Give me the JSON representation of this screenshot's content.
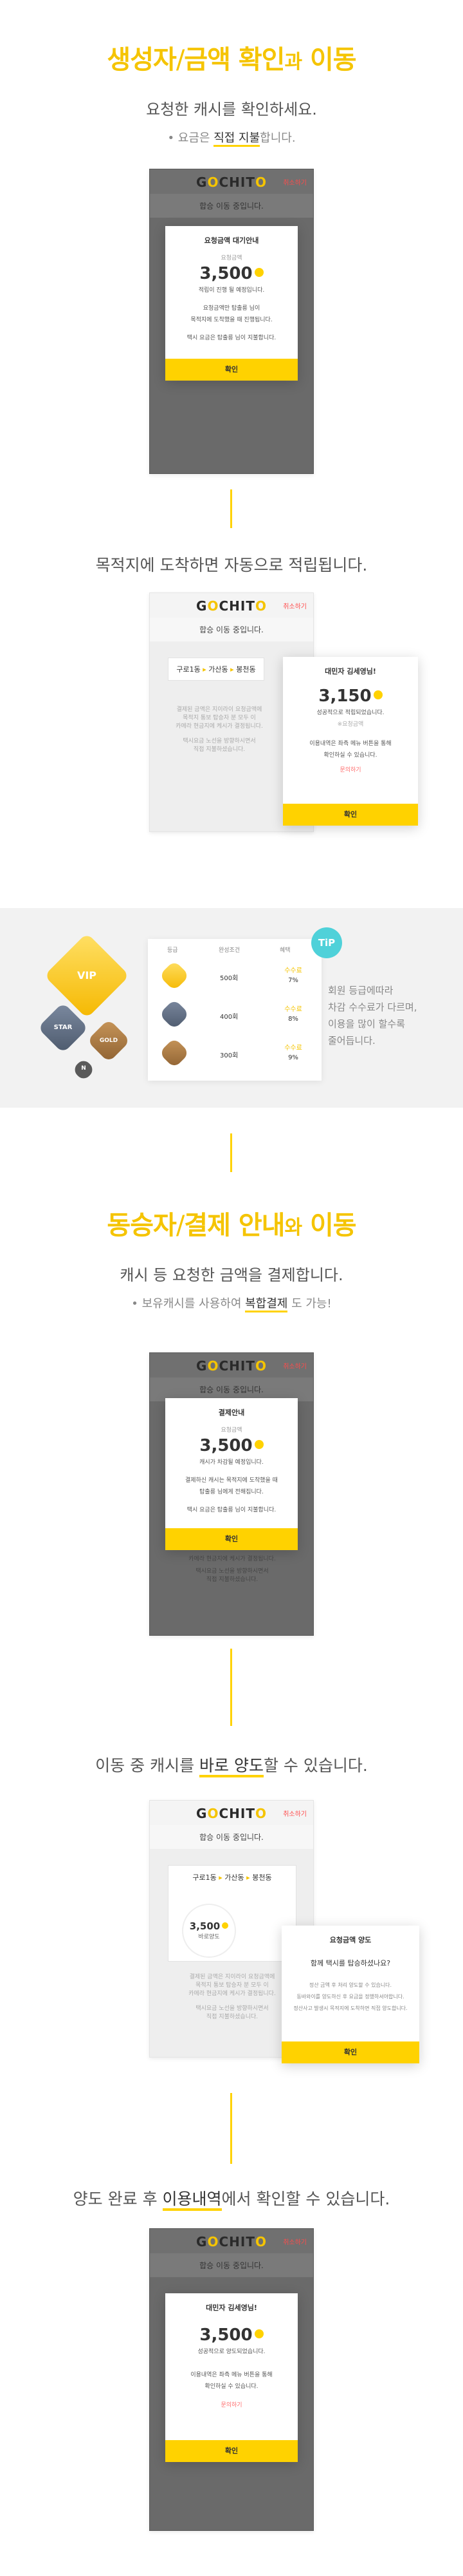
{
  "section1": {
    "title_a": "생성자",
    "slash": "/",
    "title_b": "금액 확인",
    "title_c": "과",
    "title_d": "이동",
    "subtitle": "요청한 캐시를 확인하세요.",
    "note_prefix": "• 요금은 ",
    "note_highlight": "직접 지불",
    "note_suffix": "합니다."
  },
  "phone1": {
    "logo_pre": "G",
    "logo_o": "O",
    "logo_mid": "CHIT",
    "logo_t": "O",
    "cancel": "취소하기",
    "status": "합승 이동 중입니다.",
    "modal_title": "요청금액 대기안내",
    "label": "요청금액",
    "amount": "3,500",
    "line1": "적립이 진행 될 예정입니다.",
    "line2": "요청금액만 탑출릉 님이",
    "line3": "목적지에 도착했을 때 진행됩니다.",
    "line4": "택시 요금은 탑출릉 님이 지불합니다.",
    "button": "확인"
  },
  "desc2": "목적지에 도착하면 자동으로 적립됩니다.",
  "phone2": {
    "logo_pre": "G",
    "logo_o": "O",
    "logo_mid": "CHIT",
    "logo_t": "O",
    "cancel": "취소하기",
    "status": "합승 이동 중입니다.",
    "route_from": "구로1동",
    "route_mid": "가산동",
    "route_to": "봉천동",
    "grey1": "결제된 금액은 지이라이 요청금액에",
    "grey2": "목적지 통보 탑승자 분 모두 이",
    "grey3": "카메라 현금지에 케시가 결정됩니다.",
    "grey4": "택시요금 노선을 방향하시면서",
    "grey5": "직접 지불하셨습니다.",
    "modal_title": "대민자 김세영님!",
    "amount": "3,150",
    "label": "성공적으로 적립되었습니다.",
    "sublabel": "※요청금액",
    "line1": "이용내역은 좌측 메뉴 버튼을 통해",
    "line2": "확인하실 수 있습니다.",
    "link": "문의하기",
    "button": "확인"
  },
  "vip": {
    "badge_vip": "VIP",
    "badge_star": "STAR",
    "badge_gold": "GOLD",
    "badge_normal": "N",
    "col1": "등급",
    "col2": "완성조건",
    "col3": "혜택",
    "rows": [
      {
        "cond": "500회",
        "label": "수수료",
        "pct": "7%"
      },
      {
        "cond": "400회",
        "label": "수수료",
        "pct": "8%"
      },
      {
        "cond": "300회",
        "label": "수수료",
        "pct": "9%"
      }
    ],
    "tip": "TiP",
    "tip_line1": "회원 등급에따라",
    "tip_line2": "차감 수수료가 다르며,",
    "tip_line3": "이용을 많이 할수록",
    "tip_line4": "줄어듭니다."
  },
  "section2": {
    "title_a": "동승자",
    "slash": "/",
    "title_b": "결제 안내",
    "title_c": "와",
    "title_d": "이동",
    "subtitle": "캐시 등 요청한 금액을 결제합니다.",
    "note_prefix": "• 보유캐시를 사용하여 ",
    "note_highlight": "복합결제",
    "note_suffix": " 도 가능!"
  },
  "phone3": {
    "logo_pre": "G",
    "logo_o": "O",
    "logo_mid": "CHIT",
    "logo_t": "O",
    "cancel": "취소하기",
    "status": "합승 이동 중입니다.",
    "modal_title": "결제안내",
    "label": "요청금액",
    "amount": "3,500",
    "line1": "캐시가 차감될 예정입니다.",
    "line2": "결제하신 캐시는 목적지에 도착했을 때",
    "line3": "탑출릉 님에게 전해집니다.",
    "line4": "택시 요금은 탑출릉 님이 지불합니다.",
    "button": "확인",
    "below1": "카메라 현금지에 케시가 결정됩니다.",
    "below2": "택시요금 노선을 방향하시면서",
    "below3": "직접 지불하셨습니다."
  },
  "desc4_prefix": "이동 중 캐시를 ",
  "desc4_highlight": "바로 양도",
  "desc4_suffix": "할 수 있습니다.",
  "phone4": {
    "logo_pre": "G",
    "logo_o": "O",
    "logo_mid": "CHIT",
    "logo_t": "O",
    "cancel": "취소하기",
    "status": "합승 이동 중입니다.",
    "route_from": "구로1동",
    "route_mid": "가산동",
    "route_to": "봉천동",
    "ring_amount": "3,500",
    "ring_label": "바로양도",
    "grey1": "결제된 금액은 지이라이 요청금액에",
    "grey2": "목적지 통보 탑승자 분 모두 이",
    "grey3": "카메라 현금지에 케시가 결정됩니다.",
    "grey4": "택시요금 노선을 방향하시면서",
    "grey5": "직접 지불하셨습니다.",
    "modal_title": "요청금액 양도",
    "question": "함께 택시를 탑승하셨나요?",
    "line1": "정산 금액 후 처리 양도할 수 있습니다.",
    "line2": "동바와이를 양도하신 후 요금을 정했하셔야합니다.",
    "line3": "정산사고 발생시 목적지에 도착하면 직접 양도합니다.",
    "button": "확인"
  },
  "desc5_prefix": "양도 완료 후 ",
  "desc5_highlight": "이용내역",
  "desc5_suffix": "에서 확인할 수 있습니다.",
  "phone5": {
    "logo_pre": "G",
    "logo_o": "O",
    "logo_mid": "CHIT",
    "logo_t": "O",
    "cancel": "취소하기",
    "status": "합승 이동 중입니다.",
    "modal_title": "대민자 김세영님!",
    "amount": "3,500",
    "label": "성공적으로 양도되었습니다.",
    "line1": "이용내역은 좌측 메뉴 버튼을 통해",
    "line2": "확인하실 수 있습니다.",
    "link": "문의하기",
    "button": "확인"
  },
  "colors": {
    "accent": "#ffd200",
    "title": "#f5c400",
    "tip": "#4fd1d9",
    "cancel": "#ff4b4b"
  }
}
